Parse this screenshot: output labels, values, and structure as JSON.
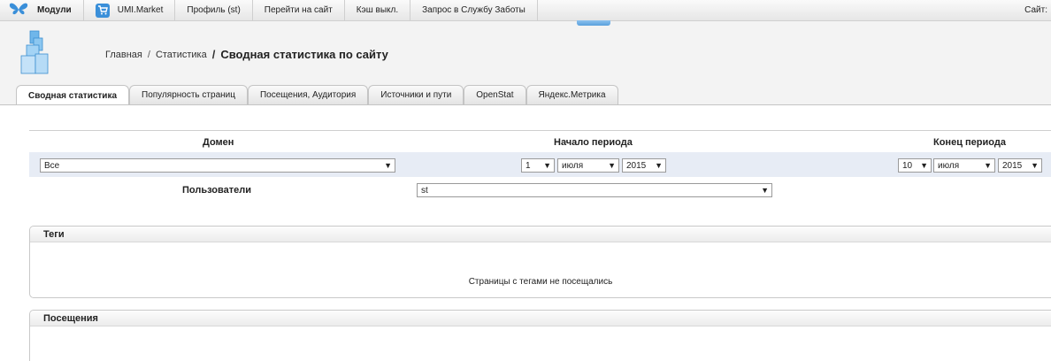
{
  "topbar": {
    "modules_label": "Модули",
    "market_label": "UMI.Market",
    "profile_label": "Профиль (st)",
    "goto_site_label": "Перейти на сайт",
    "cache_label": "Кэш выкл.",
    "support_label": "Запрос в Службу Заботы",
    "site_label": "Сайт:"
  },
  "breadcrumb": {
    "home": "Главная",
    "sep1": "/",
    "stats": "Статистика",
    "sep2": "/",
    "current": "Сводная статистика по сайту"
  },
  "tabs": [
    {
      "label": "Сводная статистика",
      "active": true
    },
    {
      "label": "Популярность страниц",
      "active": false
    },
    {
      "label": "Посещения, Аудитория",
      "active": false
    },
    {
      "label": "Источники и пути",
      "active": false
    },
    {
      "label": "OpenStat",
      "active": false
    },
    {
      "label": "Яндекс.Метрика",
      "active": false
    }
  ],
  "filters": {
    "domain_header": "Домен",
    "start_header": "Начало периода",
    "end_header": "Конец периода",
    "domain_value": "Все",
    "start_day": "1",
    "start_month": "июля",
    "start_year": "2015",
    "end_day": "10",
    "end_month": "июля",
    "end_year": "2015",
    "users_label": "Пользователи",
    "users_value": "st",
    "arrow": "▼"
  },
  "panels": {
    "tags_title": "Теги",
    "tags_empty": "Страницы с тегами не посещались",
    "visits_title": "Посещения"
  },
  "colors": {
    "accent": "#3a8fd9",
    "filter_row_bg": "#e7ecf5"
  }
}
